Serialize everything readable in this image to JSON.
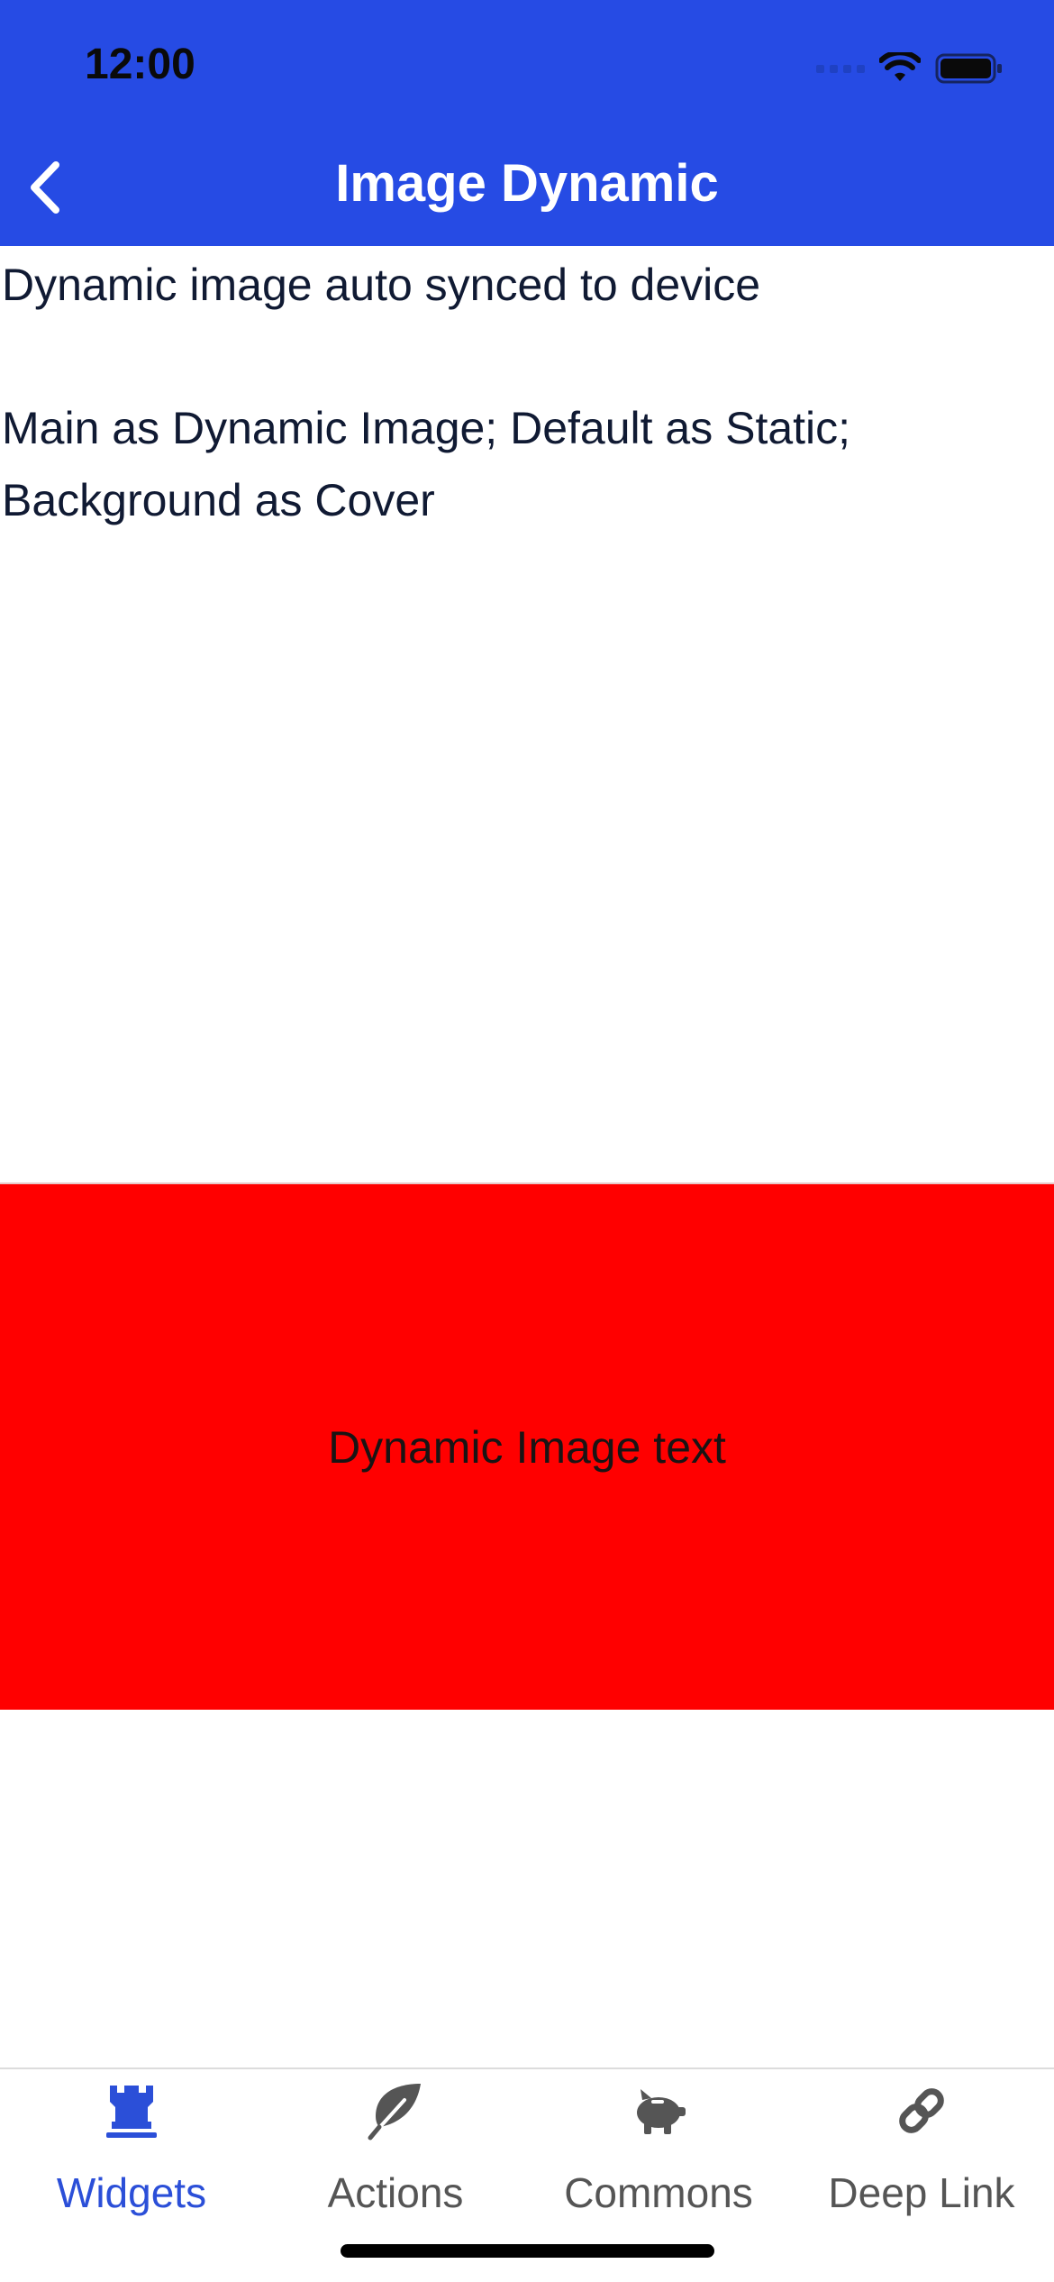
{
  "status_bar": {
    "time": "12:00"
  },
  "nav": {
    "title": "Image Dynamic",
    "back_icon": "chevron-left-icon"
  },
  "content": {
    "line1": "Dynamic image auto synced to device",
    "line2": "Main as Dynamic Image; Default as Static; Background as Cover",
    "image_text": "Dynamic Image text",
    "image_color": "#ff0000"
  },
  "tabs": [
    {
      "label": "Widgets",
      "icon": "rook-icon",
      "active": true
    },
    {
      "label": "Actions",
      "icon": "leaf-icon",
      "active": false
    },
    {
      "label": "Commons",
      "icon": "piggy-bank-icon",
      "active": false
    },
    {
      "label": "Deep Link",
      "icon": "link-icon",
      "active": false
    }
  ],
  "colors": {
    "header": "#264BE4",
    "active_tab": "#2b4fd8",
    "inactive_tab": "#555555"
  }
}
